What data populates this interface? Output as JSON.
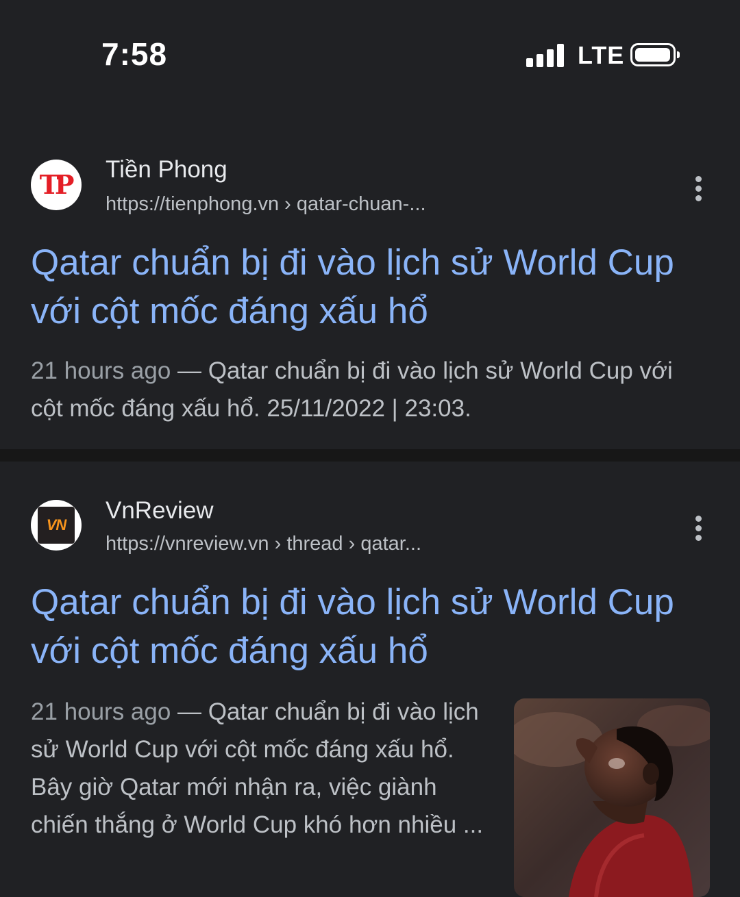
{
  "status_bar": {
    "time": "7:58",
    "network": "LTE"
  },
  "results": [
    {
      "site_name": "Tiền Phong",
      "url": "https://tienphong.vn › qatar-chuan-...",
      "favicon_text": "TP",
      "title": "Qatar chuẩn bị đi vào lịch sử World Cup với cột mốc đáng xấu hổ",
      "date": "21 hours ago",
      "snippet": " — Qatar chuẩn bị đi vào lịch sử World Cup với cột mốc đáng xấu hổ. 25/11/2022 | 23:03."
    },
    {
      "site_name": "VnReview",
      "url": "https://vnreview.vn › thread › qatar...",
      "favicon_text": "VN",
      "title": "Qatar chuẩn bị đi vào lịch sử World Cup với cột mốc đáng xấu hổ",
      "date": "21 hours ago",
      "snippet": " — Qatar chuẩn bị đi vào lịch sử World Cup với cột mốc đáng xấu hổ. Bây giờ Qatar mới nhận ra, việc giành chiến thắng ở World Cup khó hơn nhiều ..."
    }
  ],
  "colors": {
    "background": "#202124",
    "title_link": "#8ab4f8",
    "snippet_text": "#bdc1c6",
    "divider": "#171717",
    "favicon_tp": "#e41e26",
    "favicon_vn": "#f7941d"
  },
  "icons": [
    "signal-icon",
    "battery-icon",
    "more-options-icon"
  ]
}
